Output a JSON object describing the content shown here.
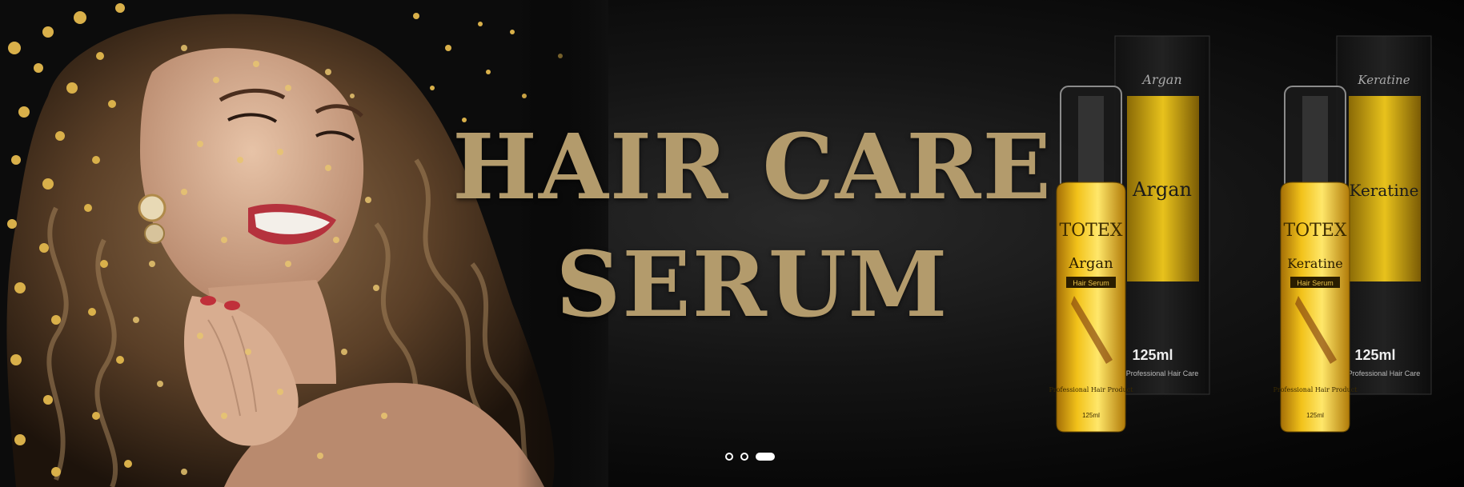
{
  "banner": {
    "headline_line1": "HAIR CARE",
    "headline_line2": "SERUM",
    "accent_color": "#b39b6c",
    "slides_total": 3,
    "active_slide": 3
  },
  "products": [
    {
      "brand": "TOTEX",
      "name": "Argan",
      "type": "Hair Serum",
      "volume": "125ml",
      "tagline": "Professional Hair Product",
      "box_text": "Professional Hair Care"
    },
    {
      "brand": "TOTEX",
      "name": "Keratine",
      "type": "Hair Serum",
      "volume": "125ml",
      "tagline": "Professional Hair Product",
      "box_text": "Professional Hair Care"
    }
  ]
}
